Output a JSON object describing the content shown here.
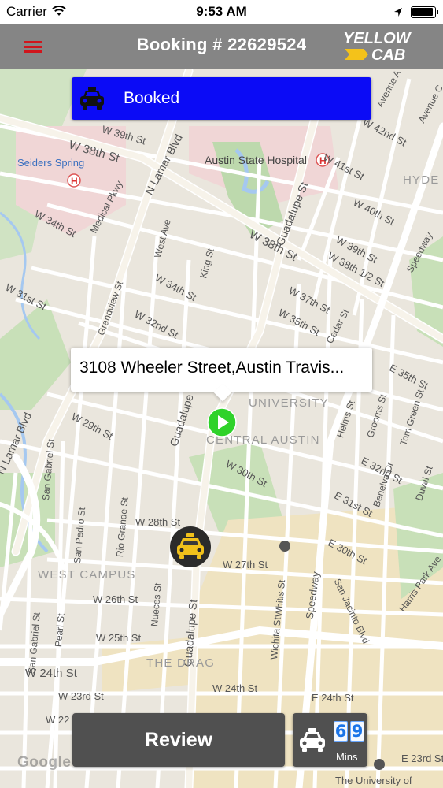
{
  "status_bar": {
    "carrier": "Carrier",
    "time": "9:53 AM"
  },
  "nav": {
    "title": "Booking # 22629524",
    "logo_line1": "YELLOW",
    "logo_line2": "CAB",
    "menu_icon": "hamburger-menu-icon"
  },
  "booking_status": {
    "label": "Booked",
    "color": "#0b0bf6",
    "icon": "taxi-icon"
  },
  "callout": {
    "address": "3108 Wheeler Street,Austin Travis..."
  },
  "actions": {
    "review_label": "Review"
  },
  "eta": {
    "digits": [
      "6",
      "9"
    ],
    "unit": "Mins",
    "icon": "taxi-icon"
  },
  "map": {
    "attribution": "Google",
    "labels": {
      "w38th_a": "W 38th St",
      "w39th_a": "W 39th St",
      "n_lamar_a": "N Lamar Blvd",
      "seiders": "Seiders Spring",
      "medical": "Medical Pkwy",
      "hospital": "Austin State Hospital",
      "w34th_a": "W 34th St",
      "w31st": "W 31st St",
      "w41st": "W 41st St",
      "avenue_a": "Avenue A",
      "w42nd": "W 42nd St",
      "avenue_c": "Avenue C",
      "hyde": "HYDE",
      "w40th": "W 40th St",
      "guadalupe_a": "Guadalupe St",
      "w38th_b": "W 38th St",
      "w39th_b": "W 39th St",
      "w38half": "W 38th 1/2 St",
      "speedway_a": "Speedway",
      "west_ave": "West Ave",
      "king": "King St",
      "grandview": "Grandview St",
      "w34th_b": "W 34th St",
      "w32nd": "W 32nd St",
      "w37th": "W 37th St",
      "w35th": "W 35th St",
      "cedar": "Cedar St",
      "e35th": "E 35th St",
      "n_lamar_b": "N Lamar Blvd",
      "w29th": "W 29th St",
      "university": "UNIVERSITY",
      "central_austin": "CENTRAL AUSTIN",
      "guadalupe_b": "Guadalupe St",
      "w30th": "W 30th St",
      "helms": "Helms St",
      "grooms": "Grooms St",
      "tom_green": "Tom Green St",
      "e32nd": "E 32nd St",
      "benelva": "Benelva Dr",
      "duval": "Duval St",
      "e31st": "E 31st St",
      "e30th": "E 30th St",
      "san_gabriel_a": "San Gabriel St",
      "san_pedro": "San Pedro St",
      "rio_grande": "Rio Grande St",
      "w28th": "W 28th St",
      "w27th": "W 27th St",
      "west_campus": "WEST CAMPUS",
      "nueces": "Nueces St",
      "guadalupe_c": "Guadalupe St",
      "whitis": "Whitis St",
      "wichita": "Wichita St",
      "speedway_b": "Speedway",
      "san_jacinto": "San Jacinto Blvd",
      "harris_park": "Harris Park Ave",
      "w26th": "W 26th St",
      "w25th": "W 25th St",
      "pearl": "Pearl St",
      "san_gabriel_b": "San Gabriel St",
      "the_drag": "THE DRAG",
      "w24th_a": "W 24th St",
      "w24th_b": "W 24th St",
      "w23rd": "W 23rd St",
      "e24th": "E 24th St",
      "w22": "W 22",
      "e23rd": "E 23rd St",
      "univ_of": "The University of"
    }
  }
}
